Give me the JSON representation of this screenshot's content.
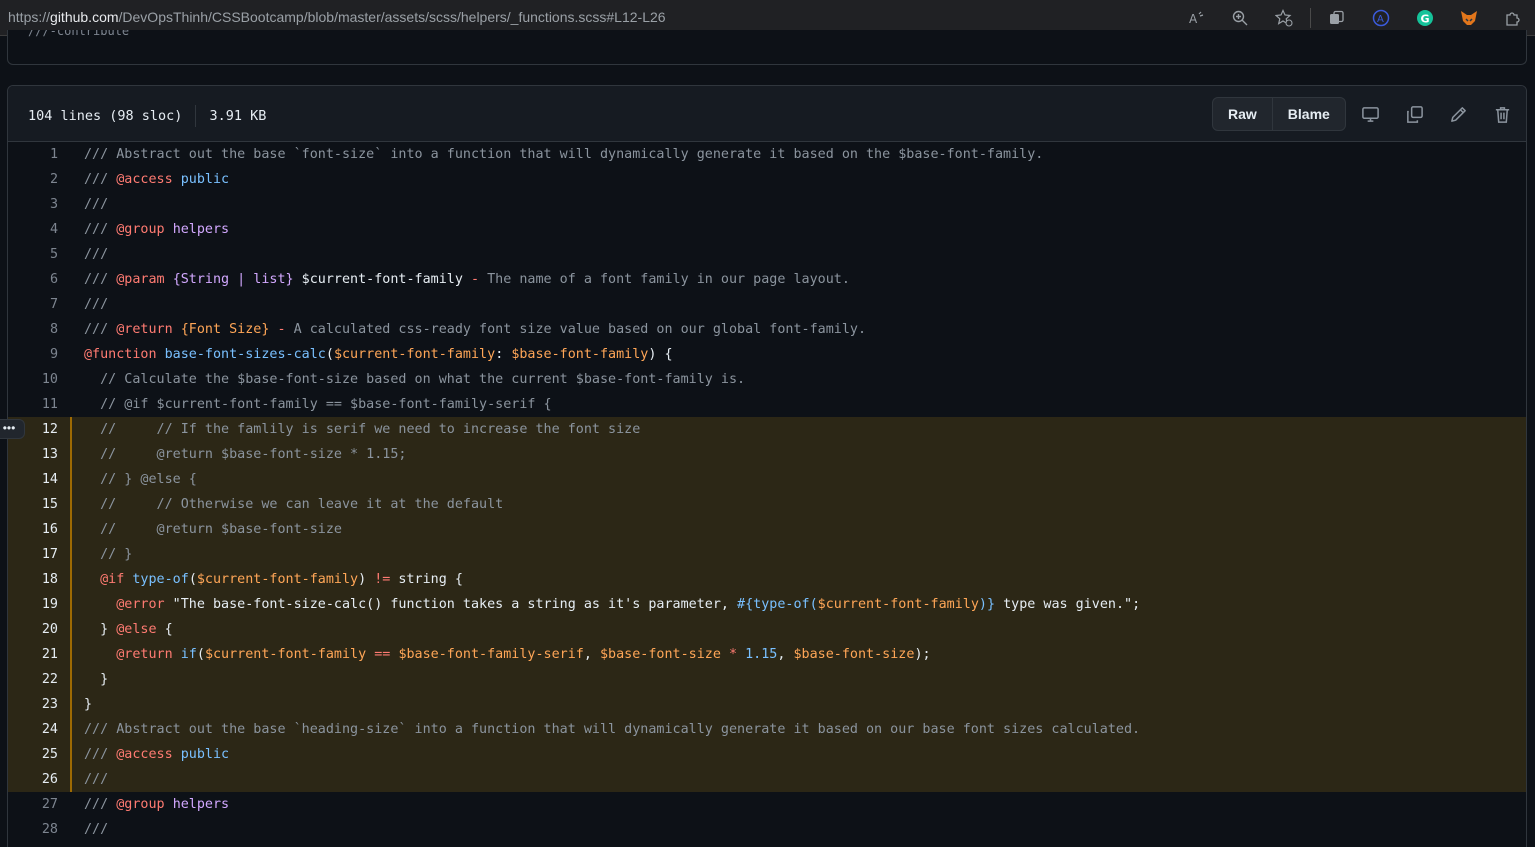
{
  "browser": {
    "url_prefix": "https://",
    "url_host": "github.com",
    "url_path": "/DevOpsThinh/CSSBootcamp/blob/master/assets/scss/helpers/_functions.scss#L12-L26",
    "icons": [
      "read-aloud-icon",
      "zoom-icon",
      "favorite-add-icon",
      "collections-icon",
      "profile-icon",
      "grammarly-icon",
      "metamask-icon",
      "extensions-icon"
    ]
  },
  "top_panel": {
    "cut_text": "///-contribute"
  },
  "file": {
    "lines_info": "104 lines (98 sloc)",
    "size": "3.91 KB",
    "raw_label": "Raw",
    "blame_label": "Blame",
    "action_icons": [
      "display-icon",
      "copy-icon",
      "edit-pencil-icon",
      "trash-icon"
    ]
  },
  "highlight": {
    "start": 12,
    "end": 26,
    "color": "#2c2716"
  },
  "code_lines": [
    {
      "n": "1",
      "segments": [
        [
          "c-com",
          "/// Abstract out the base `font-size` into a function that will dynamically generate it based on the $base-font-family."
        ]
      ]
    },
    {
      "n": "2",
      "segments": [
        [
          "c-com",
          "/// "
        ],
        [
          "c-at",
          "@access"
        ],
        [
          "c-pl",
          " "
        ],
        [
          "c-kw",
          "public"
        ]
      ]
    },
    {
      "n": "3",
      "segments": [
        [
          "c-com",
          "///"
        ]
      ]
    },
    {
      "n": "4",
      "segments": [
        [
          "c-com",
          "/// "
        ],
        [
          "c-at",
          "@group"
        ],
        [
          "c-pl",
          " "
        ],
        [
          "c-fn",
          "helpers"
        ]
      ]
    },
    {
      "n": "5",
      "segments": [
        [
          "c-com",
          "///"
        ]
      ]
    },
    {
      "n": "6",
      "segments": [
        [
          "c-com",
          "/// "
        ],
        [
          "c-at",
          "@param"
        ],
        [
          "c-pl",
          " "
        ],
        [
          "c-fn",
          "{String | list}"
        ],
        [
          "c-pl",
          " $current-font-family"
        ],
        [
          "c-at",
          " - "
        ],
        [
          "c-com",
          "The name of a font family in our page layout."
        ]
      ]
    },
    {
      "n": "7",
      "segments": [
        [
          "c-com",
          "///"
        ]
      ]
    },
    {
      "n": "8",
      "segments": [
        [
          "c-com",
          "/// "
        ],
        [
          "c-at",
          "@return"
        ],
        [
          "c-pl",
          " "
        ],
        [
          "c-var",
          "{Font Size}"
        ],
        [
          "c-at",
          " - "
        ],
        [
          "c-com",
          "A calculated css-ready font size value based on our global font-family."
        ]
      ]
    },
    {
      "n": "9",
      "segments": [
        [
          "c-at",
          "@function"
        ],
        [
          "c-pl",
          " "
        ],
        [
          "c-kw",
          "base-font-sizes-calc"
        ],
        [
          "c-pl",
          "("
        ],
        [
          "c-var",
          "$current-font-family"
        ],
        [
          "c-pl",
          ": "
        ],
        [
          "c-var",
          "$base-font-family"
        ],
        [
          "c-pl",
          ") {"
        ]
      ]
    },
    {
      "n": "10",
      "segments": [
        [
          "c-com",
          "  // Calculate the $base-font-size based on what the current $base-font-family is."
        ]
      ]
    },
    {
      "n": "11",
      "segments": [
        [
          "c-com",
          "  // @if $current-font-family == $base-font-family-serif {"
        ]
      ]
    },
    {
      "n": "12",
      "segments": [
        [
          "c-com",
          "  //     // If the famlily is serif we need to increase the font size"
        ]
      ]
    },
    {
      "n": "13",
      "segments": [
        [
          "c-com",
          "  //     @return $base-font-size * 1.15;"
        ]
      ]
    },
    {
      "n": "14",
      "segments": [
        [
          "c-com",
          "  // } @else {"
        ]
      ]
    },
    {
      "n": "15",
      "segments": [
        [
          "c-com",
          "  //     // Otherwise we can leave it at the default"
        ]
      ]
    },
    {
      "n": "16",
      "segments": [
        [
          "c-com",
          "  //     @return $base-font-size"
        ]
      ]
    },
    {
      "n": "17",
      "segments": [
        [
          "c-com",
          "  // }"
        ]
      ]
    },
    {
      "n": "18",
      "segments": [
        [
          "c-pl",
          "  "
        ],
        [
          "c-at",
          "@if"
        ],
        [
          "c-pl",
          " "
        ],
        [
          "c-kw",
          "type-of"
        ],
        [
          "c-pl",
          "("
        ],
        [
          "c-var",
          "$current-font-family"
        ],
        [
          "c-pl",
          ") "
        ],
        [
          "c-at",
          "!="
        ],
        [
          "c-pl",
          " string {"
        ]
      ]
    },
    {
      "n": "19",
      "segments": [
        [
          "c-pl",
          "    "
        ],
        [
          "c-at",
          "@error"
        ],
        [
          "c-pl",
          " \"The base-font-size-calc() function takes a string as it's parameter, "
        ],
        [
          "c-kw",
          "#{type-of("
        ],
        [
          "c-var",
          "$current-font-family"
        ],
        [
          "c-kw",
          ")}"
        ],
        [
          "c-pl",
          " type was given.\";"
        ]
      ]
    },
    {
      "n": "20",
      "segments": [
        [
          "c-pl",
          "  } "
        ],
        [
          "c-at",
          "@else"
        ],
        [
          "c-pl",
          " {"
        ]
      ]
    },
    {
      "n": "21",
      "segments": [
        [
          "c-pl",
          "    "
        ],
        [
          "c-at",
          "@return"
        ],
        [
          "c-pl",
          " "
        ],
        [
          "c-kw",
          "if"
        ],
        [
          "c-pl",
          "("
        ],
        [
          "c-var",
          "$current-font-family"
        ],
        [
          "c-pl",
          " "
        ],
        [
          "c-at",
          "=="
        ],
        [
          "c-pl",
          " "
        ],
        [
          "c-var",
          "$base-font-family-serif"
        ],
        [
          "c-pl",
          ", "
        ],
        [
          "c-var",
          "$base-font-size"
        ],
        [
          "c-pl",
          " "
        ],
        [
          "c-at",
          "*"
        ],
        [
          "c-pl",
          " "
        ],
        [
          "c-kw",
          "1.15"
        ],
        [
          "c-pl",
          ", "
        ],
        [
          "c-var",
          "$base-font-size"
        ],
        [
          "c-pl",
          ");"
        ]
      ]
    },
    {
      "n": "22",
      "segments": [
        [
          "c-pl",
          "  }"
        ]
      ]
    },
    {
      "n": "23",
      "segments": [
        [
          "c-pl",
          "}"
        ]
      ]
    },
    {
      "n": "24",
      "segments": [
        [
          "c-com",
          "/// Abstract out the base `heading-size` into a function that will dynamically generate it based on our base font sizes calculated."
        ]
      ]
    },
    {
      "n": "25",
      "segments": [
        [
          "c-com",
          "/// "
        ],
        [
          "c-at",
          "@access"
        ],
        [
          "c-pl",
          " "
        ],
        [
          "c-kw",
          "public"
        ]
      ]
    },
    {
      "n": "26",
      "segments": [
        [
          "c-com",
          "///"
        ]
      ]
    },
    {
      "n": "27",
      "segments": [
        [
          "c-com",
          "/// "
        ],
        [
          "c-at",
          "@group"
        ],
        [
          "c-pl",
          " "
        ],
        [
          "c-fn",
          "helpers"
        ]
      ]
    },
    {
      "n": "28",
      "segments": [
        [
          "c-com",
          "///"
        ]
      ]
    }
  ]
}
